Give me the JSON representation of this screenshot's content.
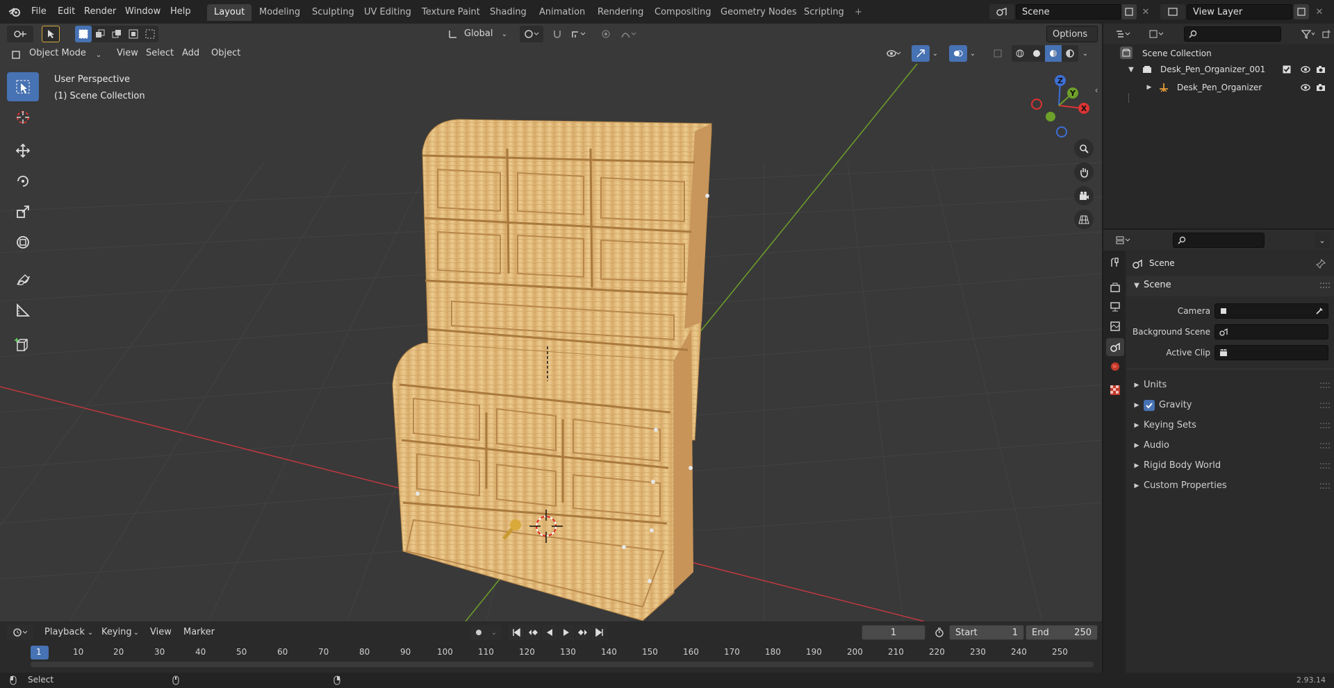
{
  "menubar": {
    "items": [
      "File",
      "Edit",
      "Render",
      "Window",
      "Help"
    ]
  },
  "workspaces": {
    "tabs": [
      "Layout",
      "Modeling",
      "Sculpting",
      "UV Editing",
      "Texture Paint",
      "Shading",
      "Animation",
      "Rendering",
      "Compositing",
      "Geometry Nodes",
      "Scripting"
    ],
    "active": "Layout",
    "add_symbol": "+"
  },
  "scene_selector": {
    "value": "Scene"
  },
  "view_layer_selector": {
    "value": "View Layer"
  },
  "viewport": {
    "transform_orientation": "Global",
    "options_label": "Options",
    "mode": "Object Mode",
    "header_menus": [
      "View",
      "Select",
      "Add",
      "Object"
    ],
    "overlay_line1": "User Perspective",
    "overlay_line2": "(1) Scene Collection",
    "gizmo_axes": {
      "x": "X",
      "y": "Y",
      "z": "Z"
    },
    "colors": {
      "background": "#3a3a3a",
      "x_axis": "#c2383f",
      "y_axis": "#6ea02a",
      "active_tool": "#4772b3"
    }
  },
  "tools": [
    "select-box-icon",
    "cursor-icon",
    "move-icon",
    "rotate-icon",
    "scale-icon",
    "transform-icon",
    "annotate-icon",
    "measure-icon",
    "add-cube-icon"
  ],
  "outliner": {
    "root": "Scene Collection",
    "items": [
      {
        "label": "Desk_Pen_Organizer_001",
        "level": 1
      },
      {
        "label": "Desk_Pen_Organizer",
        "level": 2
      }
    ]
  },
  "properties": {
    "context_label": "Scene",
    "panel_title": "Scene",
    "fields": [
      {
        "label": "Camera"
      },
      {
        "label": "Background Scene"
      },
      {
        "label": "Active Clip"
      }
    ],
    "subpanels": [
      "Units",
      "Gravity",
      "Keying Sets",
      "Audio",
      "Rigid Body World",
      "Custom Properties"
    ],
    "gravity_checked": true
  },
  "timeline": {
    "menus": [
      "Playback",
      "Keying",
      "View",
      "Marker"
    ],
    "current_frame": "1",
    "start_label": "Start",
    "start_value": "1",
    "end_label": "End",
    "end_value": "250",
    "ruler": [
      "1",
      "10",
      "20",
      "30",
      "40",
      "50",
      "60",
      "70",
      "80",
      "90",
      "100",
      "110",
      "120",
      "130",
      "140",
      "150",
      "160",
      "170",
      "180",
      "190",
      "200",
      "210",
      "220",
      "230",
      "240",
      "250"
    ]
  },
  "statusbar": {
    "left_label": "Select",
    "version": "2.93.14"
  }
}
